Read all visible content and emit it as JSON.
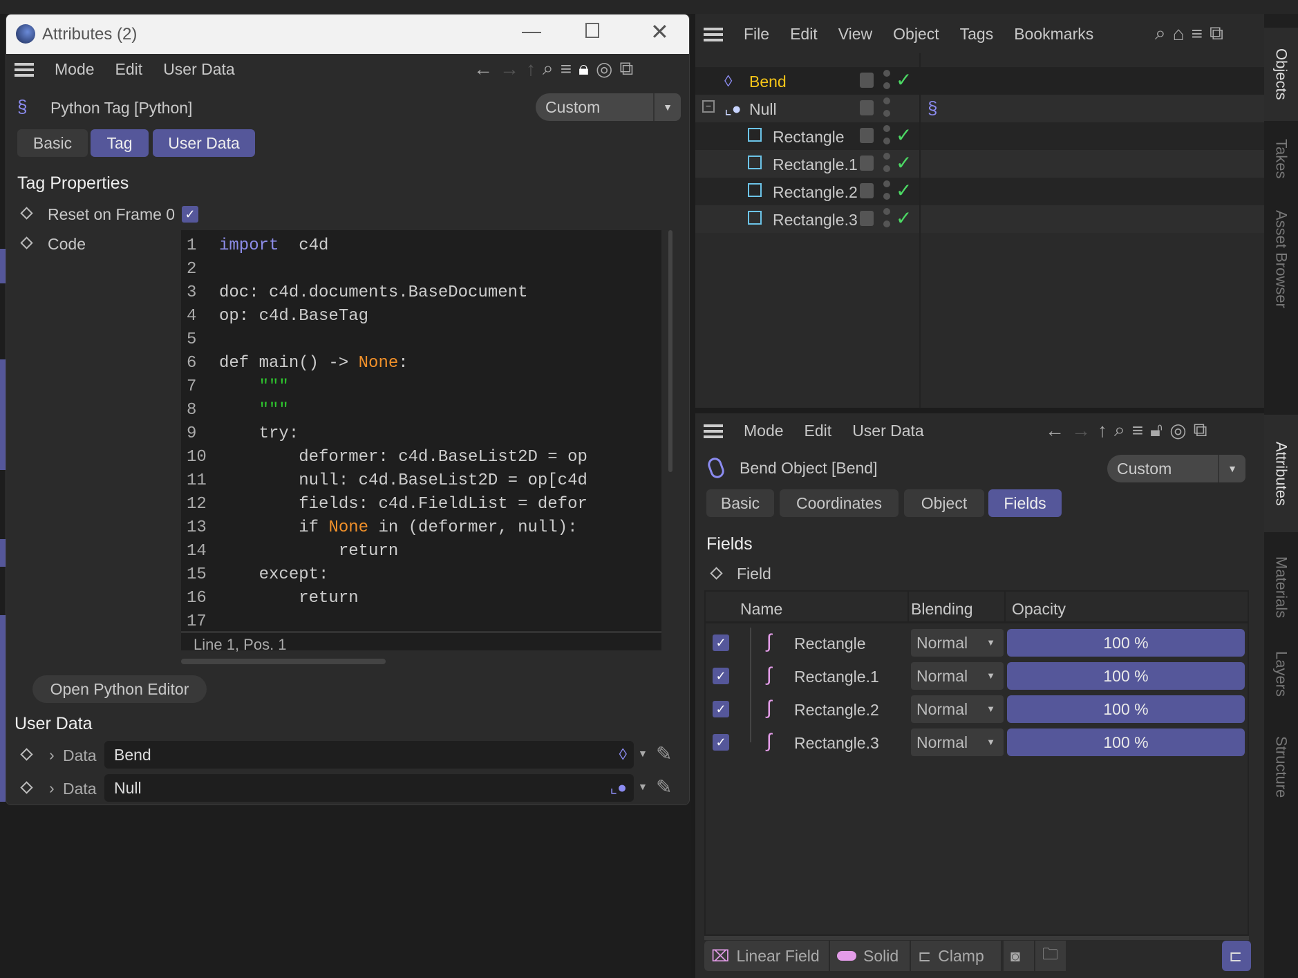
{
  "dialog": {
    "title": "Attributes (2)",
    "menu": [
      "Mode",
      "Edit",
      "User Data"
    ],
    "object_title": "Python Tag [Python]",
    "preset": "Custom",
    "tabs": [
      {
        "label": "Basic",
        "active": false
      },
      {
        "label": "Tag",
        "active": true
      },
      {
        "label": "User Data",
        "active": true
      }
    ],
    "section": "Tag Properties",
    "reset_label": "Reset on Frame 0",
    "reset_checked": true,
    "code_label": "Code",
    "code_lines": [
      {
        "n": "1",
        "parts": [
          [
            "kw",
            "import"
          ],
          [
            "",
            "  c4d"
          ]
        ]
      },
      {
        "n": "2",
        "parts": []
      },
      {
        "n": "3",
        "parts": [
          [
            "",
            "doc: c4d.documents.BaseDocument"
          ]
        ]
      },
      {
        "n": "4",
        "parts": [
          [
            "",
            "op: c4d.BaseTag"
          ]
        ]
      },
      {
        "n": "5",
        "parts": []
      },
      {
        "n": "6",
        "parts": [
          [
            "",
            "def main() -> "
          ],
          [
            "nn",
            "None"
          ],
          [
            "",
            ":"
          ]
        ]
      },
      {
        "n": "7",
        "parts": [
          [
            "st",
            "    \"\"\""
          ]
        ]
      },
      {
        "n": "8",
        "parts": [
          [
            "st",
            "    \"\"\""
          ]
        ]
      },
      {
        "n": "9",
        "parts": [
          [
            "",
            "    try:"
          ]
        ]
      },
      {
        "n": "10",
        "parts": [
          [
            "",
            "        deformer: c4d.BaseList2D = op"
          ]
        ]
      },
      {
        "n": "11",
        "parts": [
          [
            "",
            "        null: c4d.BaseList2D = op[c4d"
          ]
        ]
      },
      {
        "n": "12",
        "parts": [
          [
            "",
            "        fields: c4d.FieldList = defor"
          ]
        ]
      },
      {
        "n": "13",
        "parts": [
          [
            "",
            "        if "
          ],
          [
            "nn",
            "None"
          ],
          [
            "",
            " in (deformer, null):"
          ]
        ]
      },
      {
        "n": "14",
        "parts": [
          [
            "",
            "            return"
          ]
        ]
      },
      {
        "n": "15",
        "parts": [
          [
            "",
            "    except:"
          ]
        ]
      },
      {
        "n": "16",
        "parts": [
          [
            "",
            "        return"
          ]
        ]
      },
      {
        "n": "17",
        "parts": []
      }
    ],
    "status": "Line 1, Pos. 1",
    "open_editor": "Open Python Editor",
    "user_data_heading": "User Data",
    "user_data": [
      {
        "label": "Data",
        "value": "Bend",
        "icon": "bend-icon"
      },
      {
        "label": "Data",
        "value": "Null",
        "icon": "null-icon"
      }
    ]
  },
  "object_manager": {
    "menu": [
      "File",
      "Edit",
      "View",
      "Object",
      "Tags",
      "Bookmarks"
    ],
    "objects": [
      {
        "name": "Bend",
        "icon": "bend-icon",
        "selected": true,
        "check": true
      },
      {
        "name": "Null",
        "icon": "null-icon",
        "check": false,
        "tag": "python-icon"
      },
      {
        "name": "Rectangle",
        "check": true
      },
      {
        "name": "Rectangle.1",
        "check": true
      },
      {
        "name": "Rectangle.2",
        "check": true
      },
      {
        "name": "Rectangle.3",
        "check": true
      }
    ]
  },
  "side_tabs": [
    "Objects",
    "Takes",
    "Asset Browser",
    "Attributes",
    "Materials",
    "Layers",
    "Structure"
  ],
  "attributes": {
    "menu": [
      "Mode",
      "Edit",
      "User Data"
    ],
    "object_title": "Bend Object [Bend]",
    "preset": "Custom",
    "tabs": [
      {
        "label": "Basic",
        "active": false
      },
      {
        "label": "Coordinates",
        "active": false
      },
      {
        "label": "Object",
        "active": false
      },
      {
        "label": "Fields",
        "active": true
      }
    ],
    "section": "Fields",
    "field_label": "Field",
    "columns": [
      "Name",
      "Blending",
      "Opacity"
    ],
    "fields": [
      {
        "name": "Rectangle",
        "blending": "Normal",
        "opacity": "100 %"
      },
      {
        "name": "Rectangle.1",
        "blending": "Normal",
        "opacity": "100 %"
      },
      {
        "name": "Rectangle.2",
        "blending": "Normal",
        "opacity": "100 %"
      },
      {
        "name": "Rectangle.3",
        "blending": "Normal",
        "opacity": "100 %"
      }
    ],
    "toolbar": [
      "Linear Field",
      "Solid",
      "Clamp"
    ]
  },
  "colors": {
    "accent": "#55579a",
    "selected_name": "#f5c518",
    "check": "#4cd964",
    "field_icon": "#e39ce8"
  }
}
